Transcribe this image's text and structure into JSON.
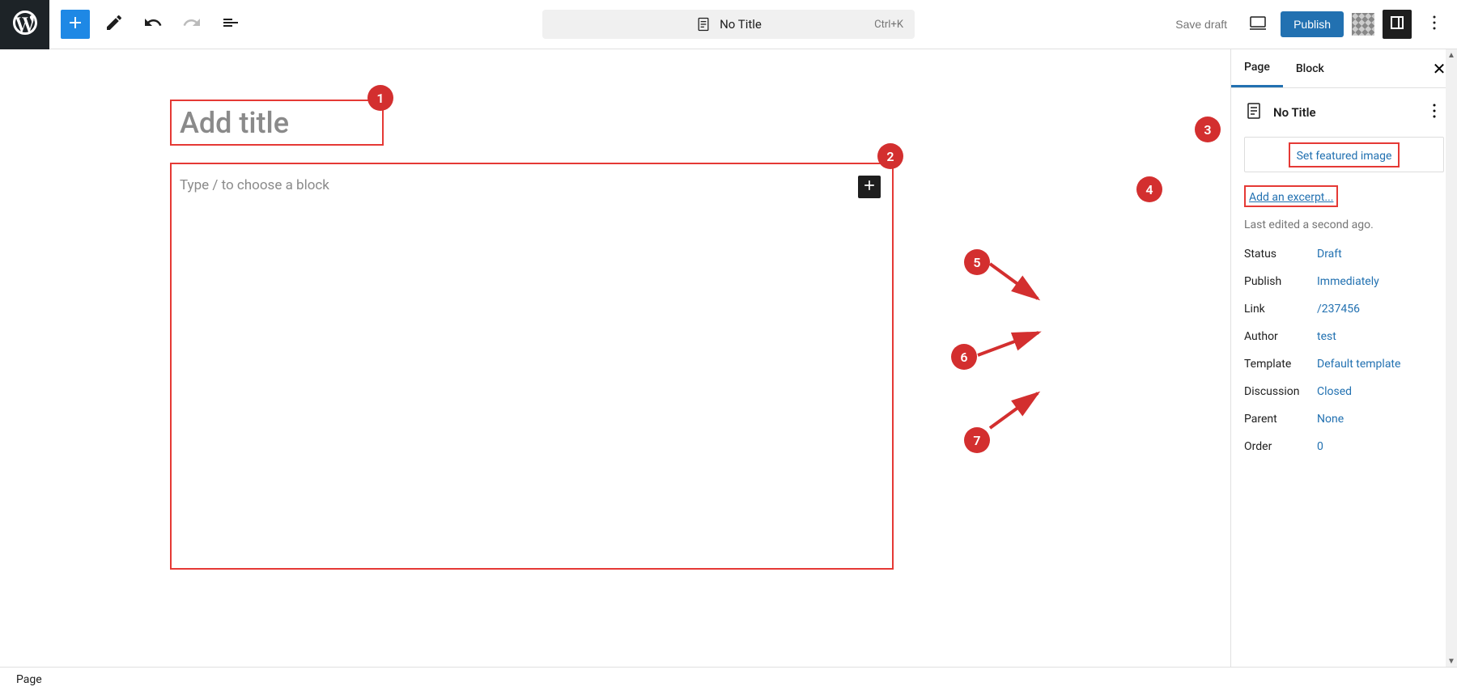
{
  "toolbar": {
    "center_title": "No Title",
    "shortcut": "Ctrl+K",
    "save_draft": "Save draft",
    "publish": "Publish"
  },
  "editor": {
    "title_placeholder": "Add title",
    "content_placeholder": "Type / to choose a block"
  },
  "sidebar": {
    "tabs": {
      "page": "Page",
      "block": "Block"
    },
    "doc_title": "No Title",
    "featured_image_label": "Set featured image",
    "excerpt_label": "Add an excerpt...",
    "last_edited": "Last edited a second ago.",
    "meta": {
      "status": {
        "label": "Status",
        "value": "Draft"
      },
      "publish": {
        "label": "Publish",
        "value": "Immediately"
      },
      "link": {
        "label": "Link",
        "value": "/237456"
      },
      "author": {
        "label": "Author",
        "value": "test"
      },
      "template": {
        "label": "Template",
        "value": "Default template"
      },
      "discussion": {
        "label": "Discussion",
        "value": "Closed"
      },
      "parent": {
        "label": "Parent",
        "value": "None"
      },
      "order": {
        "label": "Order",
        "value": "0"
      }
    }
  },
  "breadcrumb": "Page",
  "annotations": {
    "n1": "1",
    "n2": "2",
    "n3": "3",
    "n4": "4",
    "n5": "5",
    "n6": "6",
    "n7": "7"
  }
}
